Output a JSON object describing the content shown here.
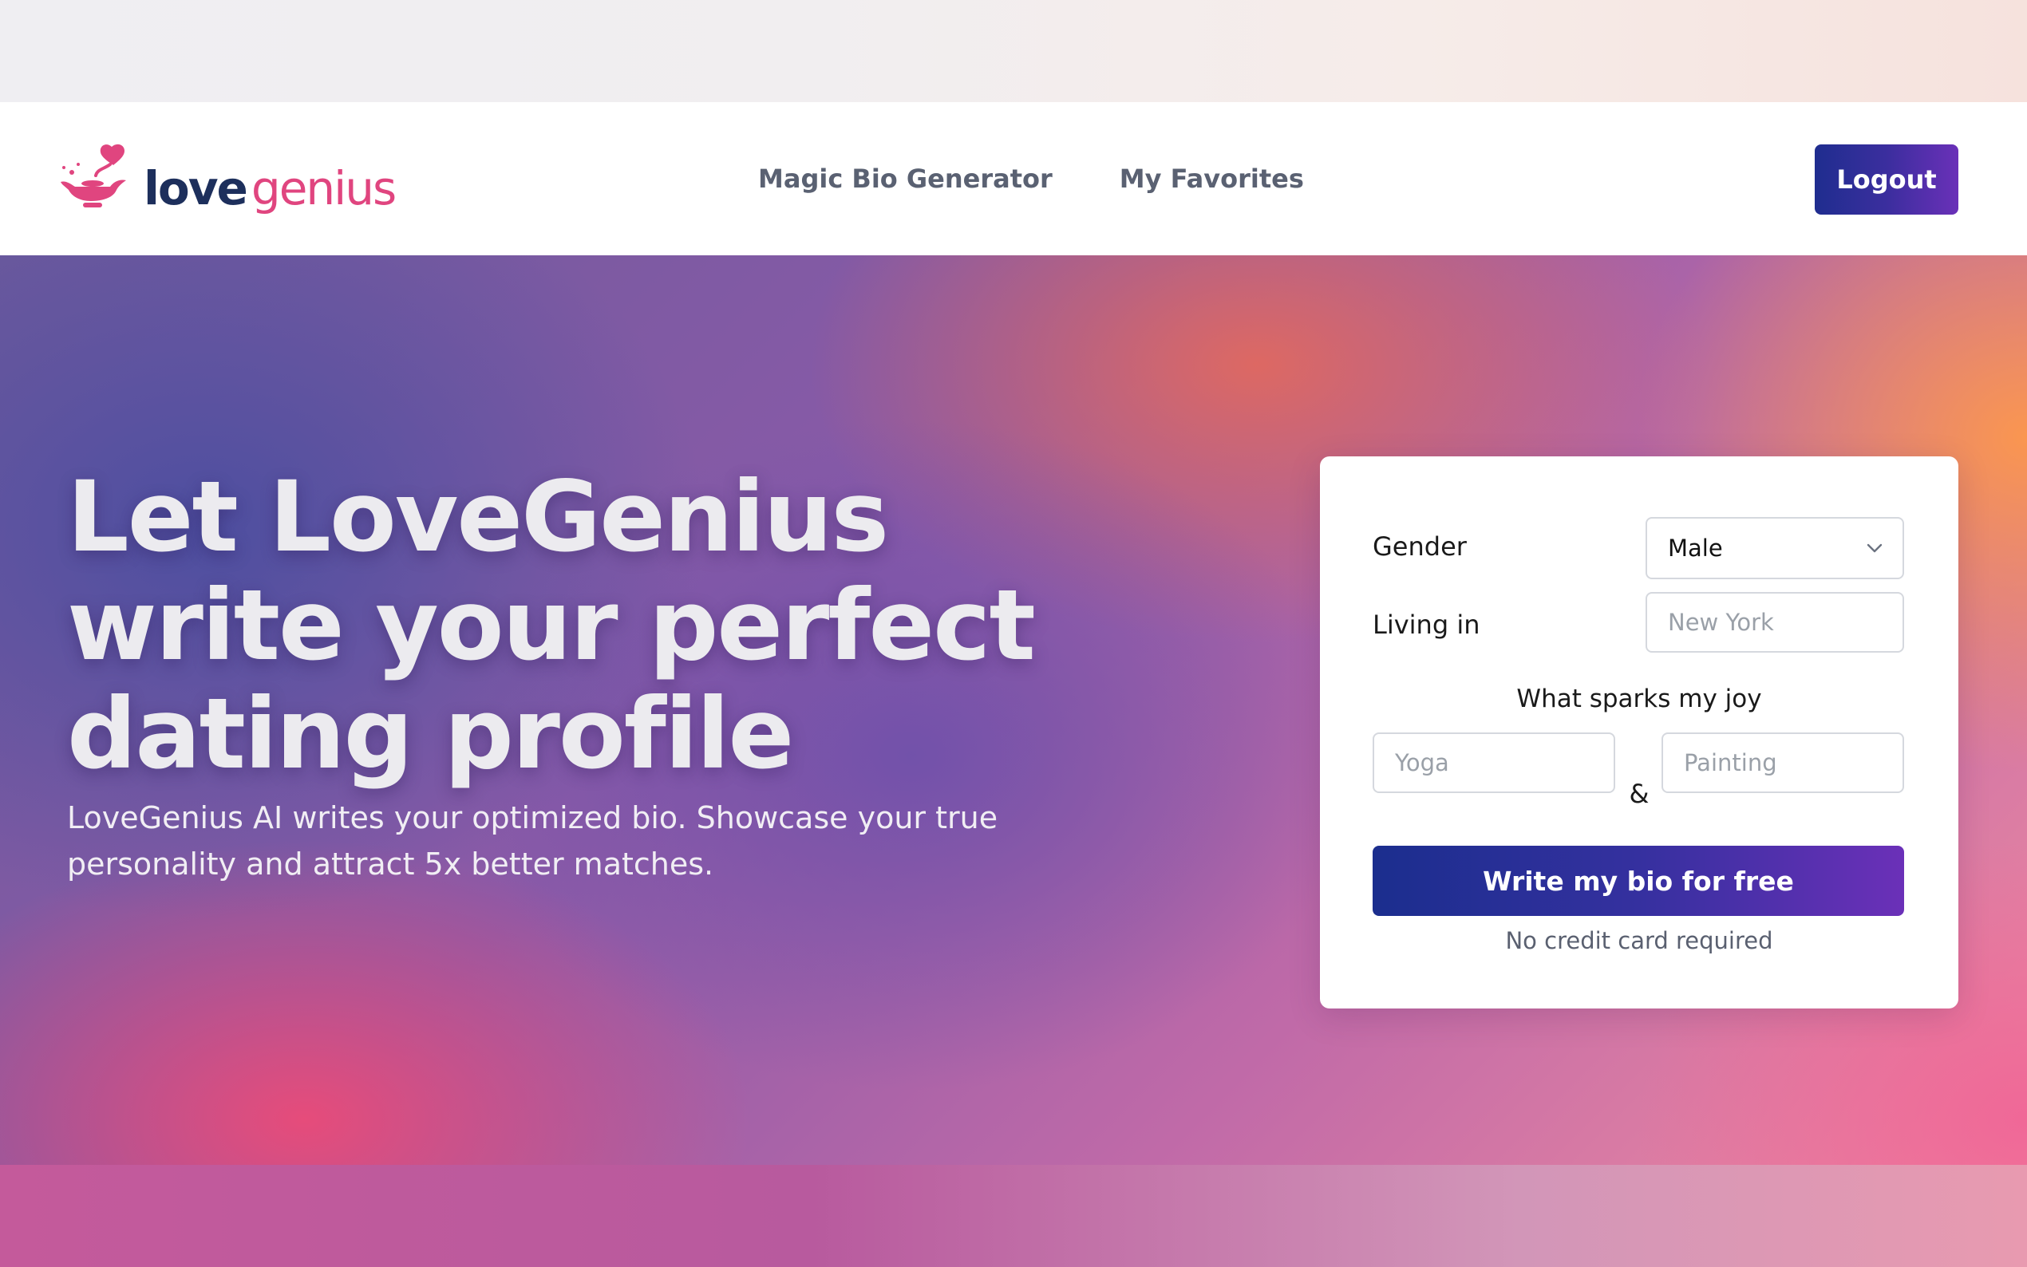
{
  "brand": {
    "name_part1": "love",
    "name_part2": "genius",
    "colors": {
      "primary": "#1d2f5c",
      "accent": "#e0457f"
    }
  },
  "nav": {
    "links": [
      {
        "label": "Magic Bio Generator"
      },
      {
        "label": "My Favorites"
      }
    ],
    "logout_label": "Logout"
  },
  "hero": {
    "title_line1": "Let LoveGenius",
    "title_line2": "write your perfect",
    "title_line3": "dating profile",
    "subtitle_line1": "LoveGenius AI writes your optimized bio. Showcase your true",
    "subtitle_line2": "personality and attract 5x better matches."
  },
  "form": {
    "gender_label": "Gender",
    "gender_value": "Male",
    "living_label": "Living in",
    "living_placeholder": "New York",
    "joy_heading": "What sparks my joy",
    "joy1_placeholder": "Yoga",
    "joy_separator": "&",
    "joy2_placeholder": "Painting",
    "submit_label": "Write my bio for free",
    "note": "No credit card required"
  },
  "icons": {
    "logo": "magic-lamp-heart-icon",
    "dropdown": "chevron-down-icon"
  }
}
